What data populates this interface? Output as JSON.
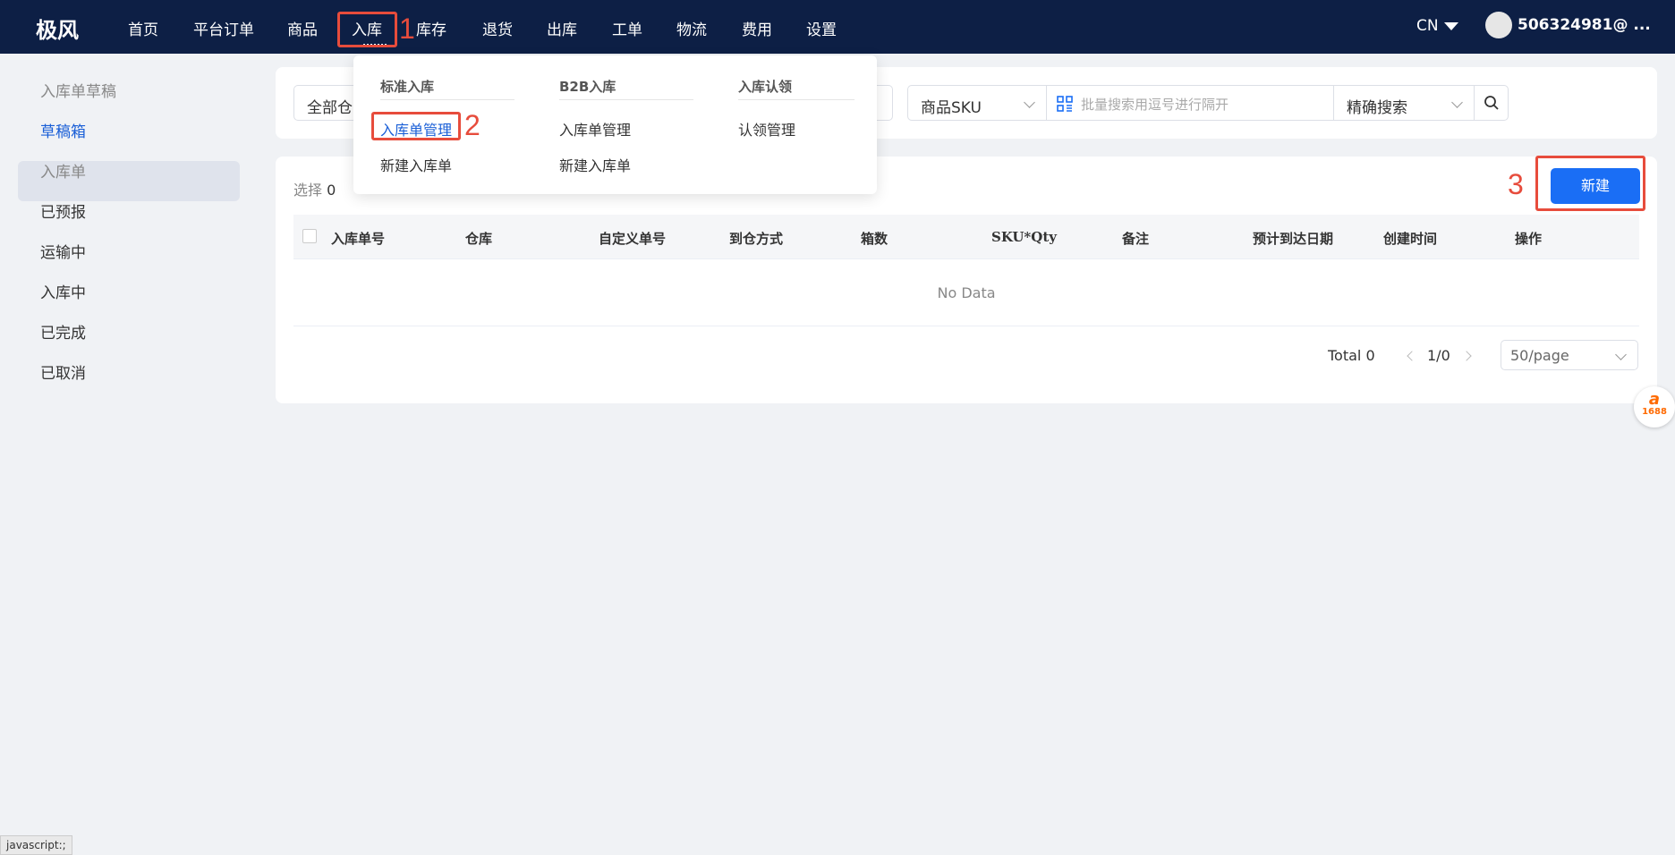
{
  "topbar": {
    "logo": "极风",
    "nav": [
      "首页",
      "平台订单",
      "商品",
      "入库",
      "库存",
      "退货",
      "出库",
      "工单",
      "物流",
      "费用",
      "设置"
    ],
    "lang": "CN",
    "user": "506324981@ ..."
  },
  "annotations": [
    "1",
    "2",
    "3"
  ],
  "sidebar": {
    "items": [
      "入库单草稿",
      "草稿箱",
      "入库单",
      "已预报",
      "运输中",
      "入库中",
      "已完成",
      "已取消"
    ]
  },
  "filters": {
    "warehouse_text": "全部仓",
    "sku_select": "商品SKU",
    "search_placeholder": "批量搜索用逗号进行隔开",
    "search_mode": "精确搜索"
  },
  "dropdown": {
    "columns": [
      {
        "title": "标准入库",
        "links": [
          "入库单管理",
          "新建入库单"
        ]
      },
      {
        "title": "B2B入库",
        "links": [
          "入库单管理",
          "新建入库单"
        ]
      },
      {
        "title": "入库认领",
        "links": [
          "认领管理"
        ]
      }
    ]
  },
  "table": {
    "selected_label": "选择",
    "selected_count": "0",
    "new_button": "新建",
    "columns": [
      "入库单号",
      "仓库",
      "自定义单号",
      "到仓方式",
      "箱数",
      "SKU*Qty",
      "备注",
      "预计到达日期",
      "创建时间",
      "操作"
    ],
    "empty_text": "No Data"
  },
  "pagination": {
    "total": "Total 0",
    "page": "1/0",
    "page_size": "50/page"
  },
  "status_bar": "javascript:;",
  "side_badge": "1688",
  "colors": {
    "nav_bg": "#0d1f45",
    "primary": "#1a6ef5",
    "annotation": "#e74c3c"
  }
}
